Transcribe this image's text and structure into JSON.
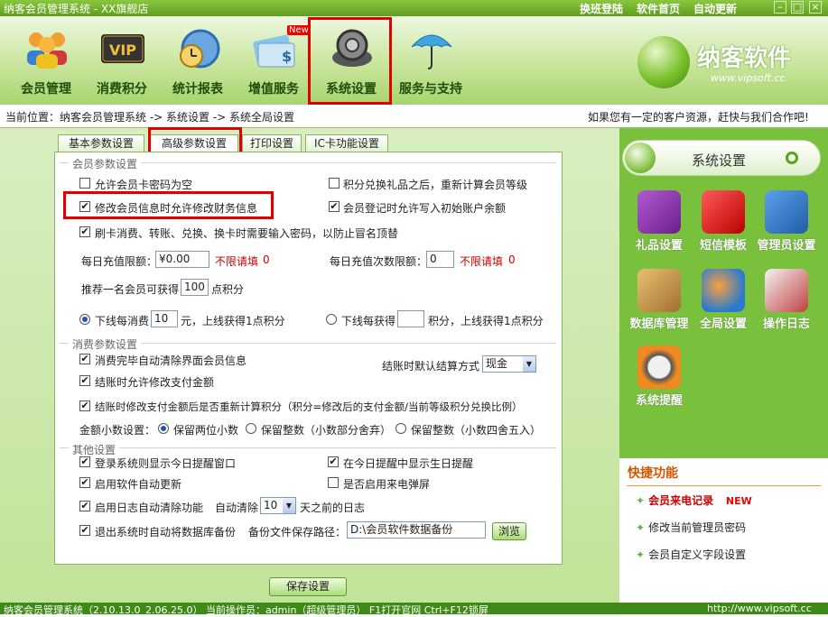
{
  "window": {
    "title": "纳客会员管理系统 - XX旗舰店",
    "links": [
      "换班登陆",
      "软件首页",
      "自动更新"
    ]
  },
  "nav": [
    {
      "label": "会员管理",
      "icon": "members-icon"
    },
    {
      "label": "消费积分",
      "icon": "vip-card-icon"
    },
    {
      "label": "统计报表",
      "icon": "clock-chart-icon"
    },
    {
      "label": "增值服务",
      "icon": "money-card-icon",
      "badge": "New"
    },
    {
      "label": "系统设置",
      "icon": "gear-icon"
    },
    {
      "label": "服务与支持",
      "icon": "umbrella-icon"
    }
  ],
  "logo": {
    "name": "纳客软件",
    "url": "www.vipsoft.cc"
  },
  "breadcrumb": "当前位置：纳客会员管理系统 -> 系统设置 -> 系统全局设置",
  "promo": "如果您有一定的客户资源，赶快与我们合作吧!",
  "tabs": [
    "基本参数设置",
    "高级参数设置",
    "打印设置",
    "IC卡功能设置"
  ],
  "member_section": {
    "title": "会员参数设置",
    "allow_empty_pwd": "允许会员卡密码为空",
    "recalc_level": "积分兑换礼品之后，重新计算会员等级",
    "allow_modify_fin": "修改会员信息时允许修改财务信息",
    "write_init_balance": "会员登记时允许写入初始账户余额",
    "swipe_pwd": "刷卡消费、转账、兑换、换卡时需要输入密码，以防止冒名顶替",
    "daily_limit_label": "每日充值限额：",
    "daily_limit_value": "¥0.00",
    "no_limit": "不限请填",
    "zero": "0",
    "daily_times_label": "每日充值次数限额：",
    "daily_times_value": "0",
    "refer_prefix": "推荐一名会员可获得",
    "refer_value": "100",
    "refer_suffix": "点积分",
    "downline_spend_prefix": "下线每消费",
    "downline_spend_value": "10",
    "downline_spend_suffix": "元，上线获得1点积分",
    "downline_earn_prefix": "下线每获得",
    "downline_earn_value": "",
    "downline_earn_suffix": "积分，上线获得1点积分"
  },
  "consume_section": {
    "title": "消费参数设置",
    "clear_after": "消费完毕自动清除界面会员信息",
    "checkout_default_label": "结账时默认结算方式",
    "checkout_default_value": "现金",
    "allow_modify_paid": "结账时允许修改支付金额",
    "recalc_points": "结账时修改支付金额后是否重新计算积分（积分=修改后的支付金额/当前等级积分兑换比例）",
    "decimal_label": "金额小数设置：",
    "decimal_opt1": "保留两位小数",
    "decimal_opt2": "保留整数（小数部分舍弃）",
    "decimal_opt3": "保留整数（小数四舍五入）"
  },
  "other_section": {
    "title": "其他设置",
    "show_reminder": "登录系统则显示今日提醒窗口",
    "show_birthday": "在今日提醒中显示生日提醒",
    "auto_update": "启用软件自动更新",
    "call_popup": "是否启用来电弹屏",
    "log_cleanup": "启用日志自动清除功能",
    "auto_clear_label": "自动清除",
    "auto_clear_value": "10",
    "auto_clear_suffix": "天之前的日志",
    "backup_on_exit": "退出系统时自动将数据库备份",
    "backup_path_label": "备份文件保存路径：",
    "backup_path_value": "D:\\会员软件数据备份",
    "browse": "浏览"
  },
  "save": "保存设置",
  "sidebar": {
    "title": "系统设置",
    "items": [
      {
        "label": "礼品设置",
        "icon": "gift-icon"
      },
      {
        "label": "短信模板",
        "icon": "sms-template-icon"
      },
      {
        "label": "管理员设置",
        "icon": "admin-lock-icon"
      },
      {
        "label": "数据库管理",
        "icon": "database-box-icon"
      },
      {
        "label": "全局设置",
        "icon": "globe-icon"
      },
      {
        "label": "操作日志",
        "icon": "log-icon"
      },
      {
        "label": "系统提醒",
        "icon": "alarm-clock-icon"
      }
    ],
    "quick_title": "快捷功能",
    "quick_items": [
      "会员来电记录",
      "修改当前管理员密码",
      "会员自定义字段设置"
    ],
    "quick_badge": "NEW"
  },
  "statusbar": {
    "text": "纳客会员管理系统（2.10.13.0_2.06.25.0） 当前操作员：admin（超级管理员） F1打开官网 Ctrl+F12锁屏",
    "url": "http://www.vipsoft.cc"
  },
  "colors": {
    "accent": "#79c03d",
    "highlight": "#e00000",
    "warning": "#cc0000"
  }
}
